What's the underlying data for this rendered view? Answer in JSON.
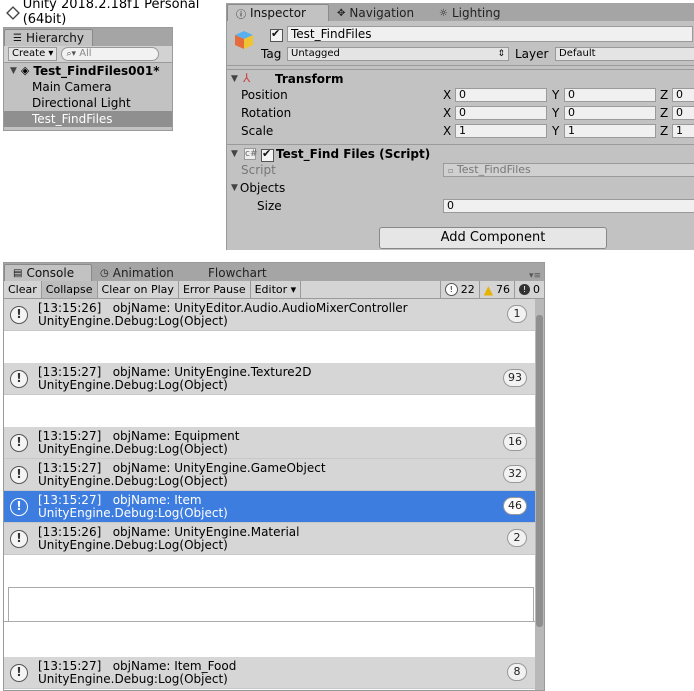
{
  "title_bar": {
    "text": "Unity 2018.2.18f1 Personal (64bit)"
  },
  "hierarchy": {
    "tab_label": "Hierarchy",
    "create_label": "Create ▾",
    "search_placeholder": "All",
    "scene_name": "Test_FindFiles001*",
    "items": [
      {
        "label": "Main Camera",
        "selected": false
      },
      {
        "label": "Directional Light",
        "selected": false
      },
      {
        "label": "Test_FindFiles",
        "selected": true
      }
    ]
  },
  "inspector": {
    "tabs": [
      "Inspector",
      "Navigation",
      "Lighting"
    ],
    "object_name": "Test_FindFiles",
    "tag_label": "Tag",
    "tag_value": "Untagged",
    "layer_label": "Layer",
    "layer_value": "Default",
    "transform": {
      "title": "Transform",
      "rows": [
        {
          "label": "Position",
          "x": "0",
          "y": "0",
          "z": "0"
        },
        {
          "label": "Rotation",
          "x": "0",
          "y": "0",
          "z": "0"
        },
        {
          "label": "Scale",
          "x": "1",
          "y": "1",
          "z": "1"
        }
      ],
      "axis_x": "X",
      "axis_y": "Y",
      "axis_z": "Z"
    },
    "script_component": {
      "title": "Test_Find Files (Script)",
      "script_label": "Script",
      "script_value": "Test_FindFiles",
      "objects_label": "Objects",
      "size_label": "Size",
      "size_value": "0"
    },
    "add_component_label": "Add Component"
  },
  "console": {
    "tabs": [
      "Console",
      "Animation",
      "Flowchart"
    ],
    "toolbar": [
      "Clear",
      "Collapse",
      "Clear on Play",
      "Error Pause",
      "Editor ▾"
    ],
    "counts": {
      "info": "22",
      "warning": "76",
      "error": "0"
    },
    "logs": [
      {
        "line1": "[13:15:26]   objName: UnityEditor.Audio.AudioMixerController",
        "line2": "UnityEngine.Debug:Log(Object)",
        "count": "1",
        "selected": false
      },
      {
        "line1": "[13:15:27]   objName: UnityEngine.Texture2D",
        "line2": "UnityEngine.Debug:Log(Object)",
        "count": "93",
        "selected": false
      },
      {
        "line1": "[13:15:27]   objName: Equipment",
        "line2": "UnityEngine.Debug:Log(Object)",
        "count": "16",
        "selected": false
      },
      {
        "line1": "[13:15:27]   objName: UnityEngine.GameObject",
        "line2": "UnityEngine.Debug:Log(Object)",
        "count": "32",
        "selected": false
      },
      {
        "line1": "[13:15:27]   objName: Item",
        "line2": "UnityEngine.Debug:Log(Object)",
        "count": "46",
        "selected": true
      },
      {
        "line1": "[13:15:26]   objName: UnityEngine.Material",
        "line2": "UnityEngine.Debug:Log(Object)",
        "count": "2",
        "selected": false
      },
      {
        "line1": "[13:15:27]   objName: Item_Food",
        "line2": "UnityEngine.Debug:Log(Object)",
        "count": "8",
        "selected": false
      }
    ]
  }
}
